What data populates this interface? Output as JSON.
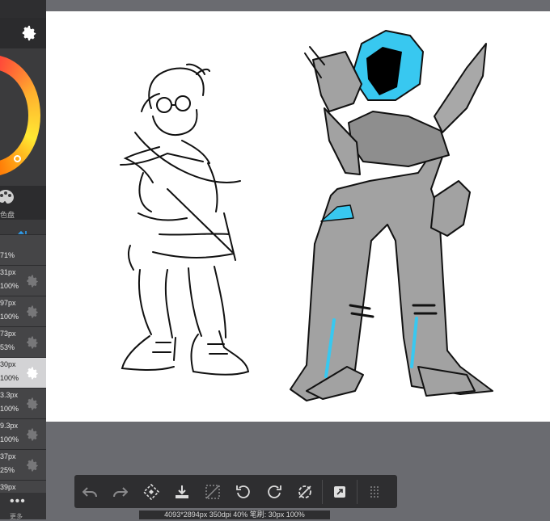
{
  "sidebar": {
    "palette_label": "色盘",
    "brushes": [
      {
        "size": "",
        "opacity": "71%"
      },
      {
        "size": "31px",
        "opacity": "100%"
      },
      {
        "size": "97px",
        "opacity": "100%"
      },
      {
        "size": "73px",
        "opacity": "53%"
      },
      {
        "size": "30px",
        "opacity": "100%",
        "selected": true
      },
      {
        "size": "3.3px",
        "opacity": "100%"
      },
      {
        "size": "9.3px",
        "opacity": "100%"
      },
      {
        "size": "37px",
        "opacity": "25%"
      },
      {
        "size": "39px",
        "opacity": ""
      }
    ],
    "more_label": "更多"
  },
  "status": {
    "text": "4093*2894px 350dpi 40% 笔刷: 30px 100%"
  },
  "colors": {
    "accent": "#38c8f0",
    "fill": "#9e9e9e",
    "ink": "#111111"
  }
}
